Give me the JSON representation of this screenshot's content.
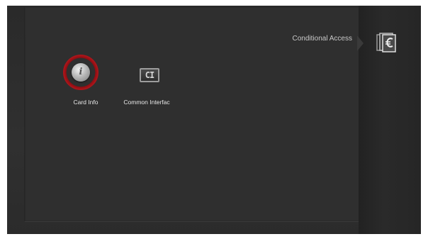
{
  "header": {
    "section_title": "Conditional Access"
  },
  "menu": {
    "items": [
      {
        "label": "Card Info",
        "icon": "info-icon",
        "selected": true
      },
      {
        "label": "Common Interfac",
        "icon": "ci-icon",
        "selected": false
      }
    ]
  },
  "sidebar": {
    "category_icon": "euro-cards-icon"
  },
  "colors": {
    "selection_ring": "#b0161b",
    "panel_background": "#2f2f2f",
    "label_text": "#e8e8e8"
  }
}
